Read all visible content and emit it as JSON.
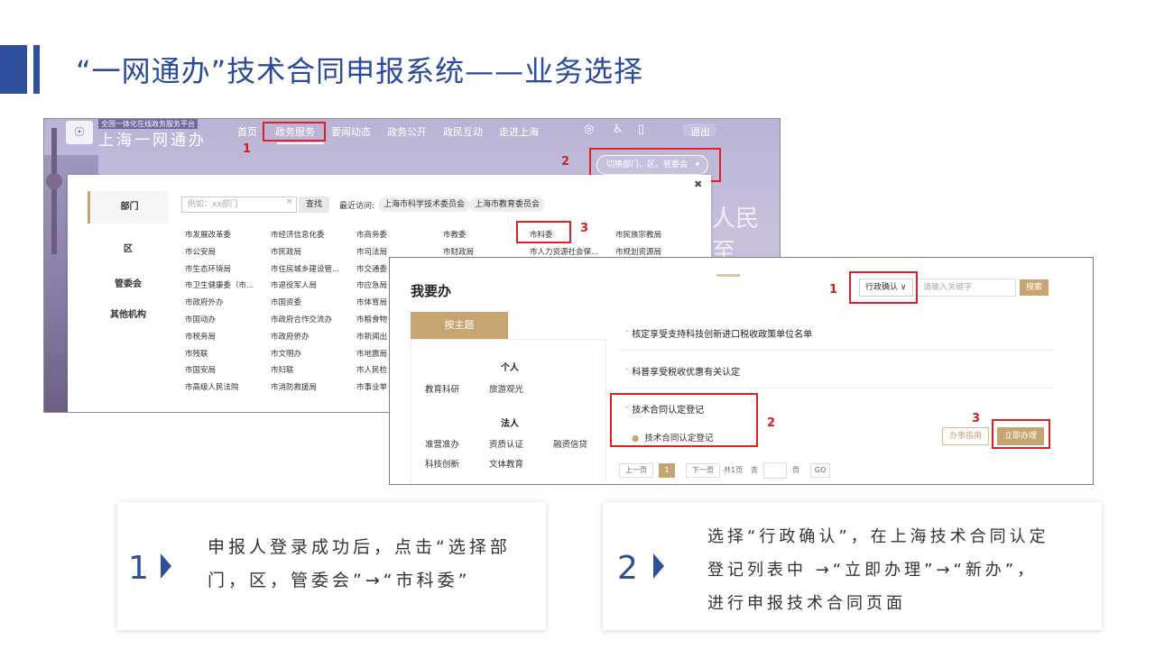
{
  "slide": {
    "title": "“一网通办”技术合同申报系统——业务选择"
  },
  "shot1": {
    "logo_small": "全国一体化在线政务服务平台",
    "logo_big": "上海一网通办",
    "nav": [
      "首页",
      "政务服务",
      "要闻动态",
      "政务公开",
      "政民互动",
      "走进上海"
    ],
    "logout": "退出",
    "switch_label": "切换部门、区、管委会",
    "deco": "人民至",
    "tabs": [
      "部门",
      "区",
      "管委会",
      "其他机构"
    ],
    "search_placeholder": "例如：xx部门",
    "search_btn": "查找",
    "recent_label": "最近访问:",
    "recent": [
      "上海市科学技术委员会",
      "上海市教育委员会"
    ],
    "depts": [
      [
        "市发展改革委",
        "市经济信息化委",
        "市商务委",
        "市教委",
        "市科委",
        "市民族宗教局"
      ],
      [
        "市公安局",
        "市民政局",
        "市司法局",
        "市财政局",
        "市人力资源社会保...",
        "市规划资源局"
      ],
      [
        "市生态环境局",
        "市住房城乡建设管...",
        "市交通委"
      ],
      [
        "市卫生健康委（市...",
        "市退役军人局",
        "市应急局"
      ],
      [
        "市政府外办",
        "市国资委",
        "市体育局"
      ],
      [
        "市国动办",
        "市政府合作交流办",
        "市粮食物"
      ],
      [
        "市税务局",
        "市政府侨办",
        "市新闻出"
      ],
      [
        "市残联",
        "市文明办",
        "市地震局"
      ],
      [
        "市国安局",
        "市妇联",
        "市人民检"
      ],
      [
        "市高级人民法院",
        "市消防救援局",
        "市事业单"
      ]
    ],
    "marks": [
      "1",
      "2",
      "3"
    ]
  },
  "shot2": {
    "title": "我要办",
    "topic_tab": "按主题",
    "personal": "个人",
    "personal_items": [
      "教育科研",
      "旅游观光"
    ],
    "legal": "法人",
    "legal_items": [
      "准营准办",
      "资质认证",
      "融资信贷",
      "科技创新",
      "文体教育"
    ],
    "select_value": "行政确认",
    "keyword_placeholder": "请输入关键字",
    "search_btn": "搜索",
    "items": [
      "核定享受支持科技创新进口税收政策单位名单",
      "科普享受税收优惠有关认定",
      "技术合同认定登记"
    ],
    "sub_item": "技术合同认定登记",
    "guide_btn": "办事指南",
    "apply_btn": "立即办理",
    "pager": {
      "prev": "上一页",
      "current": "1",
      "next": "下一页",
      "total": "共1页",
      "goto": "去",
      "page": "页",
      "go": "GO"
    },
    "marks": [
      "1",
      "2",
      "3"
    ]
  },
  "cards": [
    {
      "num": "1",
      "lines": [
        "申报人登录成功后，点击“选择部",
        "门，区，管委会”→“市科委”"
      ]
    },
    {
      "num": "2",
      "lines": [
        "选择“行政确认”，在上海技术合同认定",
        "登记列表中 →“立即办理”→“新办”，",
        "进行申报技术合同页面"
      ]
    }
  ]
}
